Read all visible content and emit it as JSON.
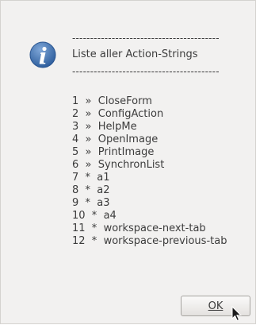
{
  "dialog": {
    "separator": "-----------------------------------------",
    "title": "Liste aller Action-Strings",
    "items": [
      "1  »  CloseForm",
      "2  »  ConfigAction",
      "3  »  HelpMe",
      "4  »  OpenImage",
      "5  »  PrintImage",
      "6  »  SynchronList",
      "7  *  a1",
      "8  *  a2",
      "9  *  a3",
      "10  *  a4",
      "11  *  workspace-next-tab",
      "12  *  workspace-previous-tab"
    ],
    "ok_label": "OK",
    "icon": "info-icon",
    "icon_color": "#3a6aa8"
  }
}
